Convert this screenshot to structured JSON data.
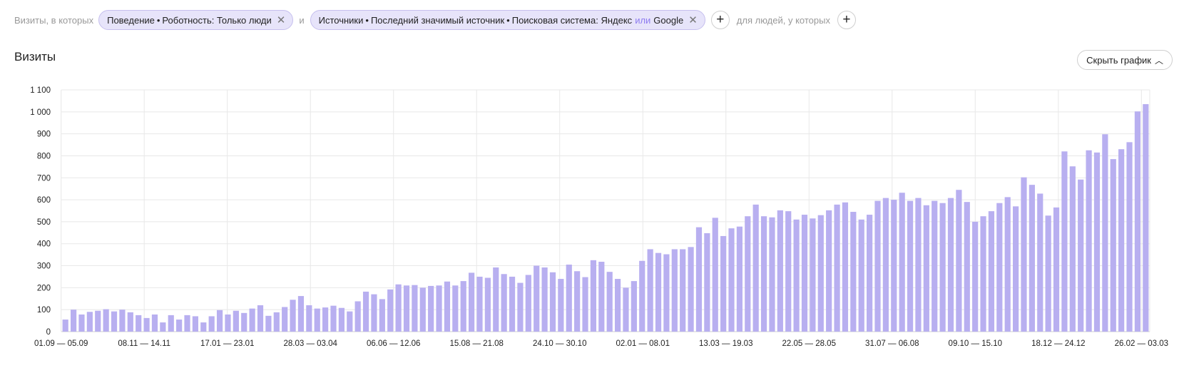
{
  "filters": {
    "prefix": "Визиты, в которых",
    "chip1": {
      "category": "Поведение",
      "field": "Роботность",
      "value": "Только люди"
    },
    "and_word": "и",
    "chip2": {
      "category": "Источники",
      "field": "Последний значимый источник",
      "subfield": "Поисковая система",
      "value1": "Яндекс",
      "or_word": "или",
      "value2": "Google"
    },
    "people_label": "для людей, у которых"
  },
  "header": {
    "title": "Визиты",
    "hide_chart_label": "Скрыть график"
  },
  "colors": {
    "bar": "#b8aff0",
    "grid": "#e8e8e8"
  },
  "chart_data": {
    "type": "bar",
    "title": "",
    "xlabel": "",
    "ylabel": "",
    "ylim": [
      0,
      1100
    ],
    "yticks": [
      "0",
      "100",
      "200",
      "300",
      "400",
      "500",
      "600",
      "700",
      "800",
      "900",
      "1 000",
      "1 100"
    ],
    "xticks": [
      "01.09 — 05.09",
      "08.11 — 14.11",
      "17.01 — 23.01",
      "28.03 — 03.04",
      "06.06 — 12.06",
      "15.08 — 21.08",
      "24.10 — 30.10",
      "02.01 — 08.01",
      "13.03 — 19.03",
      "22.05 — 28.05",
      "31.07 — 06.08",
      "09.10 — 15.10",
      "18.12 — 24.12",
      "26.02 — 03.03"
    ],
    "values": [
      55,
      100,
      78,
      90,
      95,
      102,
      92,
      100,
      88,
      75,
      62,
      78,
      42,
      75,
      55,
      75,
      70,
      42,
      70,
      98,
      78,
      95,
      85,
      105,
      120,
      72,
      88,
      112,
      145,
      162,
      120,
      105,
      110,
      118,
      108,
      92,
      138,
      182,
      170,
      148,
      192,
      215,
      210,
      212,
      200,
      208,
      210,
      228,
      210,
      230,
      268,
      250,
      245,
      292,
      262,
      250,
      222,
      258,
      300,
      292,
      270,
      240,
      305,
      275,
      248,
      325,
      318,
      272,
      240,
      200,
      230,
      322,
      375,
      358,
      352,
      375,
      375,
      385,
      475,
      448,
      518,
      435,
      470,
      478,
      525,
      578,
      525,
      520,
      552,
      548,
      510,
      532,
      515,
      530,
      552,
      578,
      588,
      545,
      510,
      532,
      595,
      608,
      600,
      632,
      595,
      608,
      575,
      595,
      585,
      608,
      645,
      590,
      500,
      525,
      548,
      585,
      612,
      570,
      702,
      668,
      628,
      528,
      565,
      820,
      752,
      692,
      825,
      815,
      898,
      785,
      830,
      862,
      1002,
      1035
    ]
  }
}
